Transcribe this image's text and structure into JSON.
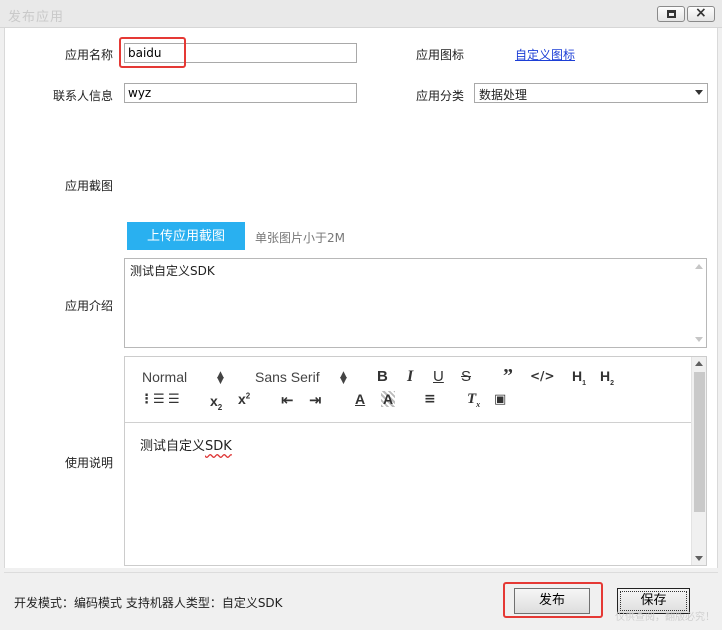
{
  "window": {
    "title": "发布应用",
    "colors": {
      "accent": "#29b0f0",
      "highlight": "#e53935",
      "link": "#1d3fd6"
    }
  },
  "form": {
    "app_name_label": "应用名称",
    "app_name_value": "baidu",
    "contact_label": "联系人信息",
    "contact_value": "wyz",
    "app_icon_label": "应用图标",
    "app_icon_link": "自定义图标",
    "category_label": "应用分类",
    "category_value": "数据处理",
    "screenshot_label": "应用截图",
    "upload_button": "上传应用截图",
    "upload_hint": "单张图片小于2M",
    "intro_label": "应用介绍",
    "intro_value": "测试自定义SDK",
    "usage_label": "使用说明"
  },
  "editor": {
    "header_picker": "Normal",
    "font_picker": "Sans Serif",
    "content_prefix": "测试自定义",
    "content_sdk": "SDK",
    "tools": [
      "bold-icon",
      "italic-icon",
      "underline-icon",
      "strike-icon",
      "blockquote-icon",
      "code-icon",
      "header1-icon",
      "header2-icon",
      "ordered-list-icon",
      "bullet-list-icon",
      "subscript-icon",
      "superscript-icon",
      "outdent-icon",
      "indent-icon",
      "text-color-icon",
      "background-color-icon",
      "align-icon",
      "clear-format-icon",
      "image-icon"
    ]
  },
  "footer": {
    "mode_text": "开发模式：编码模式   支持机器人类型：自定义SDK",
    "publish_button": "发布",
    "save_button": "保存",
    "watermark": "仅供查阅，翻版必究！"
  }
}
